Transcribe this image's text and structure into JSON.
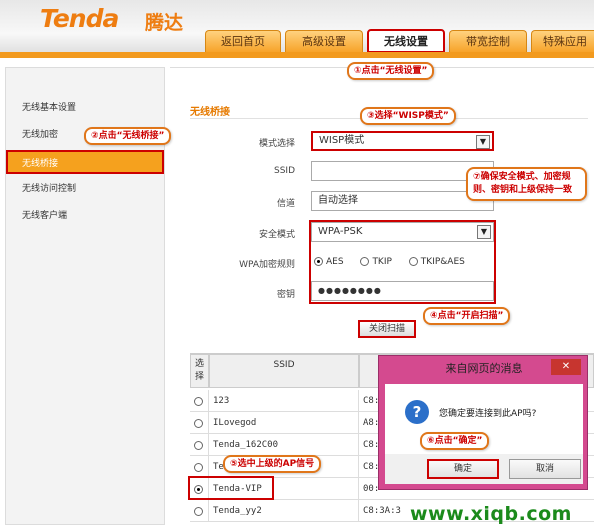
{
  "header": {
    "logo": "Tenda",
    "logo_cn": "腾达",
    "tabs": [
      {
        "label": "返回首页"
      },
      {
        "label": "高级设置"
      },
      {
        "label": "无线设置"
      },
      {
        "label": "带宽控制"
      },
      {
        "label": "特殊应用"
      }
    ]
  },
  "sidebar": {
    "items": [
      {
        "label": "无线基本设置"
      },
      {
        "label": "无线加密"
      },
      {
        "label": "无线桥接"
      },
      {
        "label": "无线访问控制"
      },
      {
        "label": "无线客户端"
      }
    ]
  },
  "main": {
    "section_title": "无线桥接",
    "mode_label": "模式选择",
    "mode_value": "WISP模式",
    "ssid_label": "SSID",
    "ssid_value": "",
    "channel_label": "信道",
    "channel_value": "自动选择",
    "security_label": "安全模式",
    "security_value": "WPA-PSK",
    "wpa_rule_label": "WPA加密规则",
    "wpa_options": [
      "AES",
      "TKIP",
      "TKIP&AES"
    ],
    "key_label": "密钥",
    "key_value": "●●●●●●●●",
    "scan_button": "关闭扫描"
  },
  "table": {
    "headers": [
      "选择",
      "SSID"
    ],
    "rows": [
      {
        "ssid": "123",
        "mac": "C8:"
      },
      {
        "ssid": "ILovegod",
        "mac": "A8:"
      },
      {
        "ssid": "Tenda_162C00",
        "mac": "C8:"
      },
      {
        "ssid": "Ten",
        "mac": "C8:"
      },
      {
        "ssid": "Tenda-VIP",
        "mac": "00:"
      },
      {
        "ssid": "Tenda_yy2",
        "mac": "C8:3A:3"
      }
    ]
  },
  "dialog": {
    "title": "来自网页的消息",
    "close": "✕",
    "message": "您确定要连接到此AP吗?",
    "ok": "确定",
    "cancel": "取消"
  },
  "callouts": {
    "c1": "①点击“无线设置”",
    "c2": "②点击“无线桥接”",
    "c3": "③选择“WISP模式”",
    "c4": "④点击“开启扫描”",
    "c5": "⑤选中上级的AP信号",
    "c6": "⑥点击“确定”",
    "c7": "⑦确保安全模式、加密规则、密钥和上级保持一致"
  },
  "watermark": "www.xiqb.com",
  "colors": {
    "accent": "#f29a1e",
    "highlight": "#cc0000",
    "dialog": "#d44a8f"
  }
}
